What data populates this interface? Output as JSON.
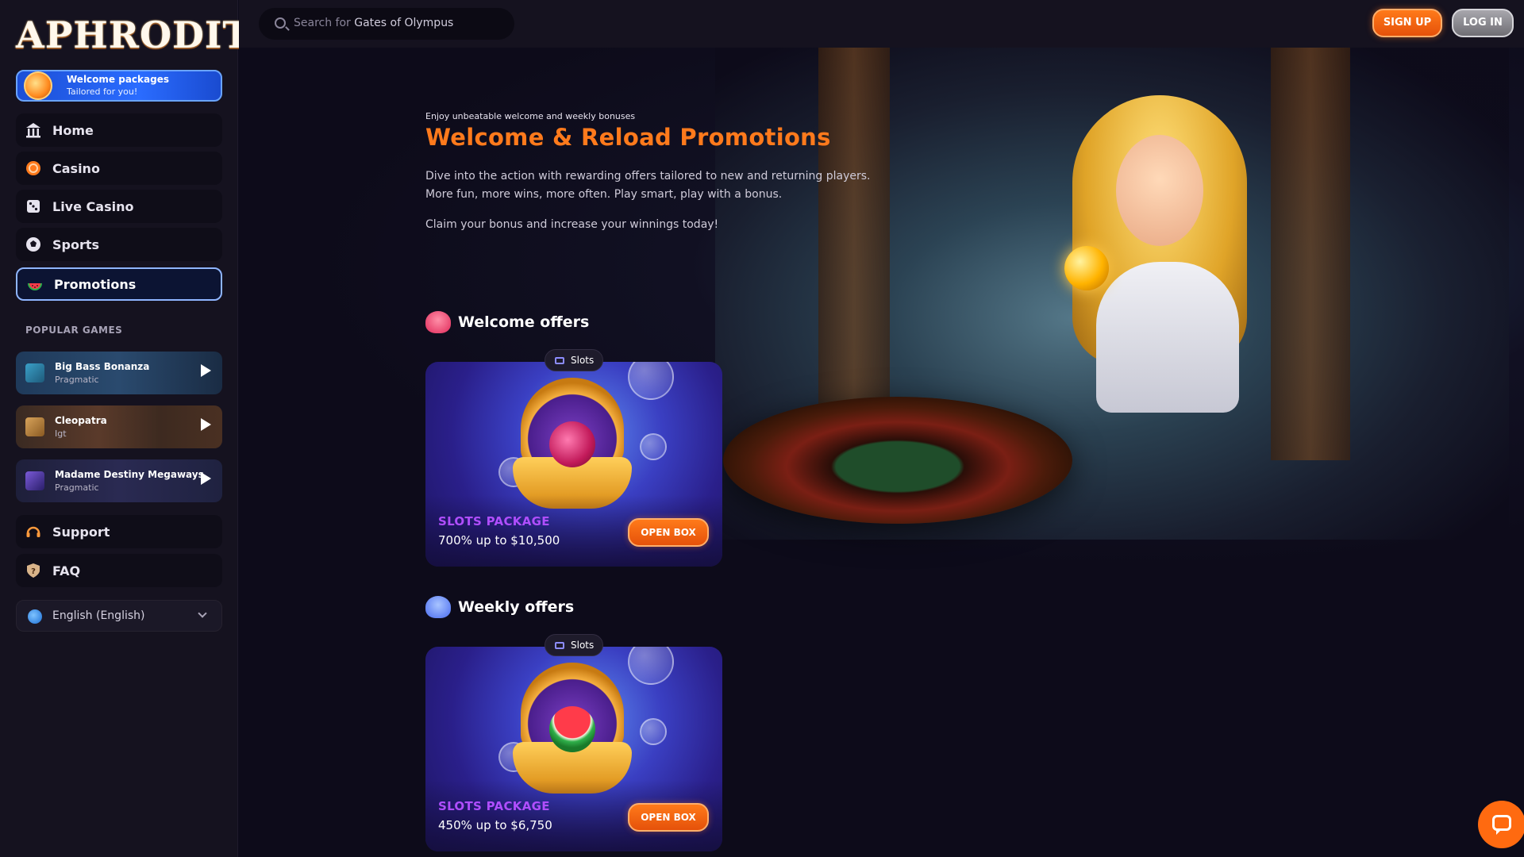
{
  "brand": {
    "logo_text": "APHRODITE"
  },
  "welcome_banner": {
    "line1": "Welcome packages",
    "line2": "Tailored for you!"
  },
  "nav": [
    {
      "label": "Home",
      "icon": "temple-icon"
    },
    {
      "label": "Casino",
      "icon": "casino-chip-icon"
    },
    {
      "label": "Live Casino",
      "icon": "dice-icon"
    },
    {
      "label": "Sports",
      "icon": "soccer-ball-icon"
    },
    {
      "label": "Promotions",
      "icon": "watermelon-icon",
      "active": true
    }
  ],
  "popular_games": {
    "title": "POPULAR GAMES",
    "items": [
      {
        "name": "Big Bass Bonanza",
        "provider": "Pragmatic"
      },
      {
        "name": "Cleopatra",
        "provider": "Igt"
      },
      {
        "name": "Madame Destiny Megaways",
        "provider": "Pragmatic"
      }
    ]
  },
  "support": {
    "support_label": "Support",
    "faq_label": "FAQ"
  },
  "language": {
    "label": "English (English)"
  },
  "search": {
    "prefix": "Search for ",
    "placeholder_game": "Gates of Olympus"
  },
  "auth": {
    "signup": "SIGN UP",
    "login": "LOG IN"
  },
  "hero": {
    "eyebrow": "Enjoy unbeatable welcome and weekly bonuses",
    "title": "Welcome & Reload Promotions",
    "desc_line1": "Dive into the action with rewarding offers tailored to new and returning players.",
    "desc_line2": "More fun, more wins, more often. Play smart, play with a bonus.",
    "desc_line3": "Claim your bonus and increase your winnings today!"
  },
  "welcome_offers": {
    "title": "Welcome offers",
    "card": {
      "tag": "Slots",
      "package": "SLOTS PACKAGE",
      "amount": "700% up to $10,500",
      "button": "OPEN BOX"
    }
  },
  "weekly_offers": {
    "title": "Weekly offers",
    "card": {
      "tag": "Slots",
      "package": "SLOTS PACKAGE",
      "amount": "450% up to $6,750",
      "button": "OPEN BOX"
    }
  },
  "colors": {
    "accent_orange": "#ff7a1c",
    "package_purple": "#b04eff",
    "active_border": "#8fb5ff",
    "background": "#0d0b1a"
  }
}
